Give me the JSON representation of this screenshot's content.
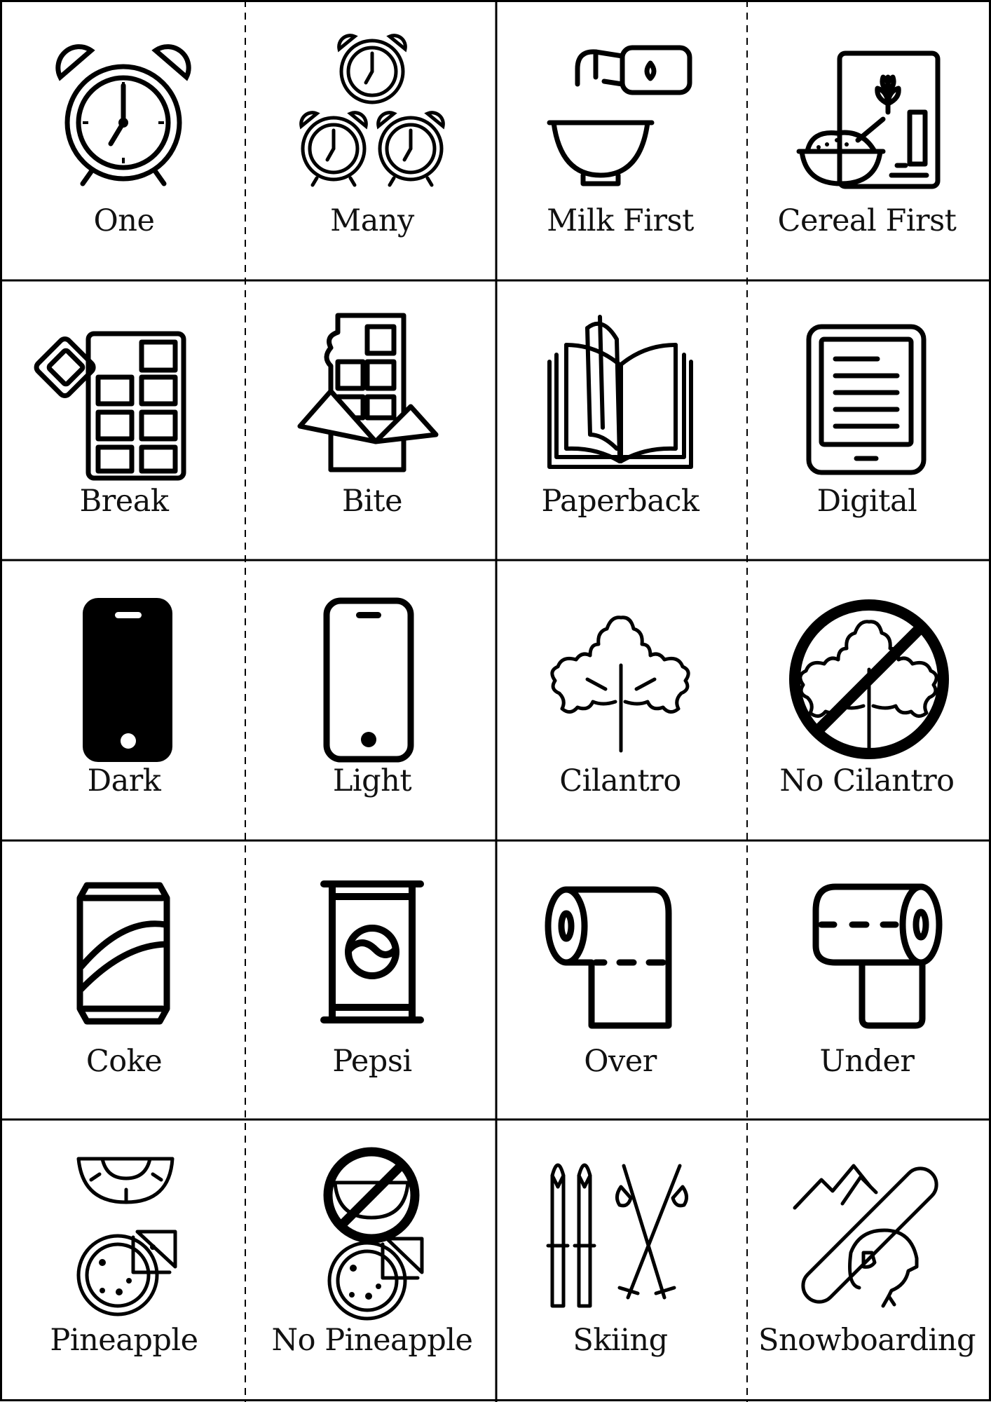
{
  "cards": [
    {
      "label": "One",
      "icon": "alarm-clock-icon"
    },
    {
      "label": "Many",
      "icon": "three-alarm-clocks-icon"
    },
    {
      "label": "Milk First",
      "icon": "milk-pouring-into-bowl-icon"
    },
    {
      "label": "Cereal First",
      "icon": "cereal-box-and-bowl-icon"
    },
    {
      "label": "Break",
      "icon": "chocolate-bar-broken-icon"
    },
    {
      "label": "Bite",
      "icon": "chocolate-bar-bitten-icon"
    },
    {
      "label": "Paperback",
      "icon": "open-book-icon"
    },
    {
      "label": "Digital",
      "icon": "e-reader-icon"
    },
    {
      "label": "Dark",
      "icon": "phone-dark-mode-icon"
    },
    {
      "label": "Light",
      "icon": "phone-light-mode-icon"
    },
    {
      "label": "Cilantro",
      "icon": "cilantro-leaf-icon"
    },
    {
      "label": "No Cilantro",
      "icon": "no-cilantro-icon"
    },
    {
      "label": "Coke",
      "icon": "coke-can-icon"
    },
    {
      "label": "Pepsi",
      "icon": "pepsi-can-icon"
    },
    {
      "label": "Over",
      "icon": "toilet-paper-over-icon"
    },
    {
      "label": "Under",
      "icon": "toilet-paper-under-icon"
    },
    {
      "label": "Pineapple",
      "icon": "pineapple-pizza-icon"
    },
    {
      "label": "No Pineapple",
      "icon": "no-pineapple-pizza-icon"
    },
    {
      "label": "Skiing",
      "icon": "skis-and-poles-icon"
    },
    {
      "label": "Snowboarding",
      "icon": "snowboard-and-helmet-icon"
    }
  ]
}
